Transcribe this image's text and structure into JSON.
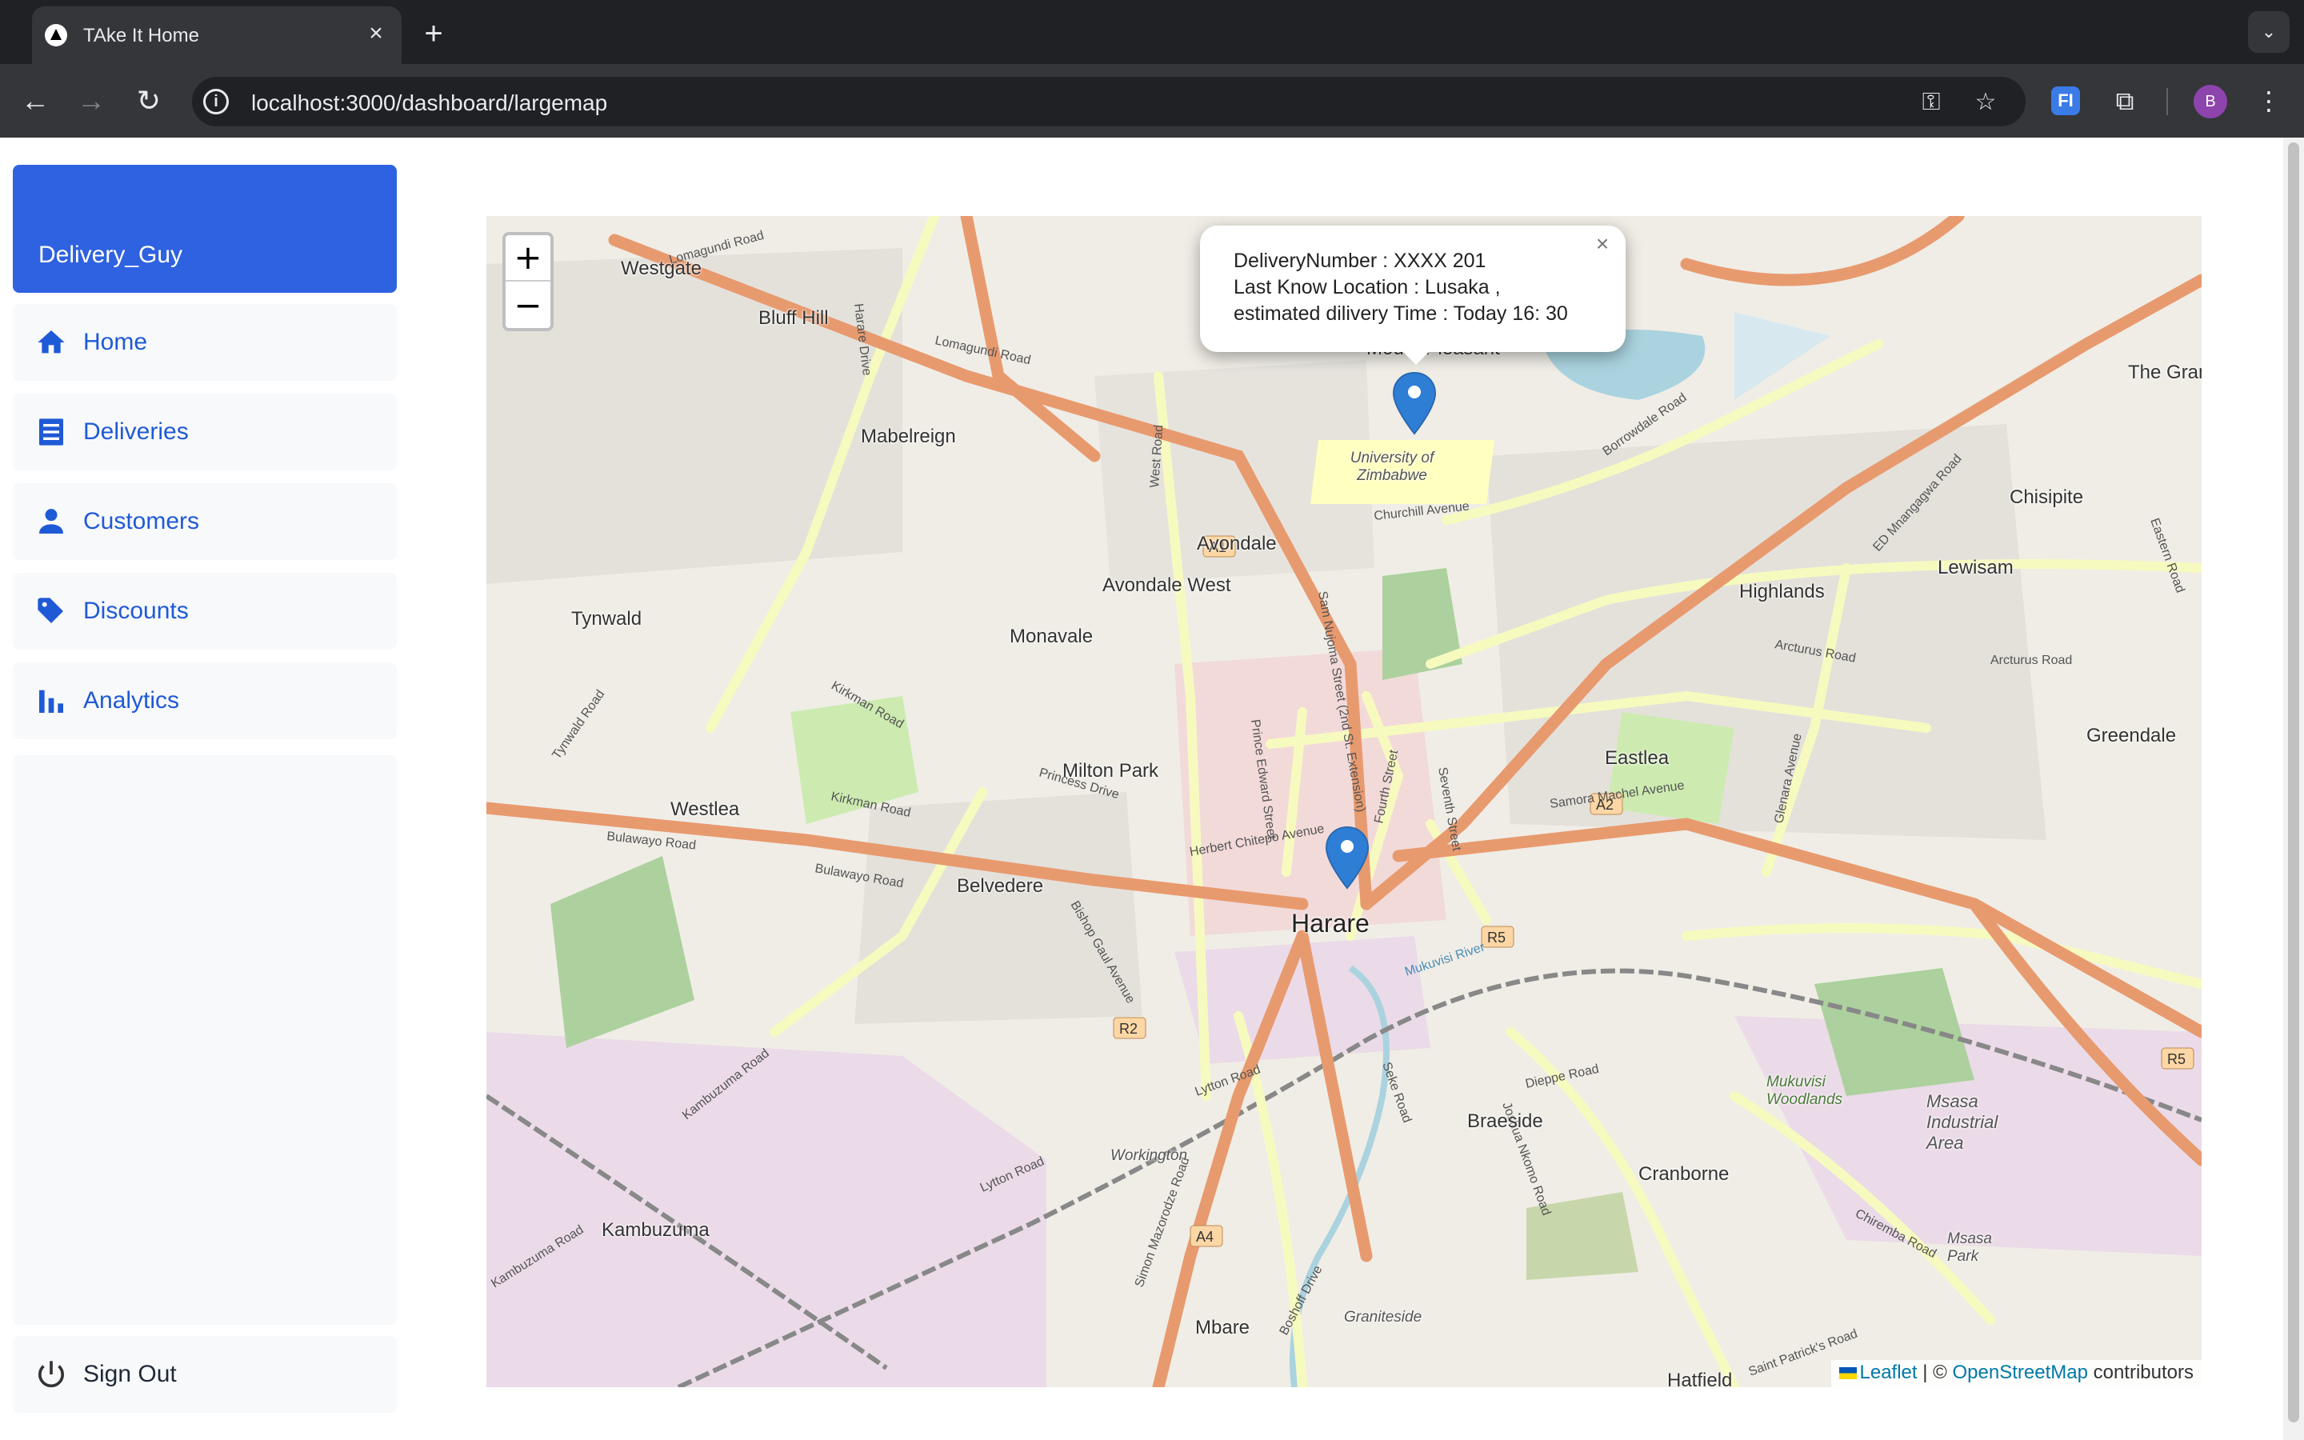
{
  "browser": {
    "tab_title": "TAke It Home",
    "url": "localhost:3000/dashboard/largemap",
    "profile_initial": "B",
    "extension_label": "FI"
  },
  "sidebar": {
    "user_name": "Delivery_Guy",
    "items": [
      {
        "label": "Home",
        "icon": "home-icon"
      },
      {
        "label": "Deliveries",
        "icon": "list-icon"
      },
      {
        "label": "Customers",
        "icon": "person-icon"
      },
      {
        "label": "Discounts",
        "icon": "tag-icon"
      },
      {
        "label": "Analytics",
        "icon": "bar-chart-icon"
      }
    ],
    "sign_out": "Sign Out",
    "accent": "#2f62e0"
  },
  "map": {
    "zoom_in": "+",
    "zoom_out": "−",
    "popup": {
      "line1": "DeliveryNumber : XXXX 201",
      "line2": "Last Know Location : Lusaka ,",
      "line3": "estimated dilivery Time : Today 16: 30"
    },
    "places": [
      "Westgate",
      "Bluff Hill",
      "Mabelreign",
      "Mount Pleasant",
      "University of Zimbabwe",
      "Avondale",
      "Avondale West",
      "Monavale",
      "Tynwald",
      "Highlands",
      "Chisipite",
      "Lewisam",
      "The Grange",
      "Eastlea",
      "Greendale",
      "Milton Park",
      "Westlea",
      "Belvedere",
      "Harare",
      "Braeside",
      "Cranborne",
      "Msasa Industrial Area",
      "Msasa Park",
      "Mukuvisi Woodlands",
      "Kambuzuma",
      "Workington",
      "Graniteside",
      "Mbare",
      "Hatfield"
    ],
    "roads": [
      "Lomagundi Road",
      "Harare Drive",
      "Borrowdale Road",
      "Churchill Avenue",
      "Samora Machel Avenue",
      "Bulawayo Road",
      "Kirkman Road",
      "Tynwald Road",
      "Princess Drive",
      "Herbert Chitepo Avenue",
      "Arcturus Road",
      "Eastern Road",
      "ED Mnangagwa Road",
      "Glenara Avenue",
      "Sam Nujoma Street (2nd St. Extension)",
      "Fourth Street",
      "Seventh Street",
      "Prince Edward Street",
      "West Road",
      "Bishop Gaul Avenue",
      "Lytton Road",
      "Dieppe Road",
      "Seke Road",
      "Chiremba Road",
      "Saint Patrick's Road",
      "Simon Mazorodze Road",
      "Kambuzuma Road",
      "Boshoff Drive",
      "Mukuvisi River",
      "Joshua Nkomo Road"
    ],
    "shields": [
      "A1",
      "A2",
      "R2",
      "R5",
      "A4"
    ],
    "attribution": {
      "leaflet": "Leaflet",
      "sep": "| ©",
      "osm": "OpenStreetMap",
      "tail": "contributors"
    }
  }
}
